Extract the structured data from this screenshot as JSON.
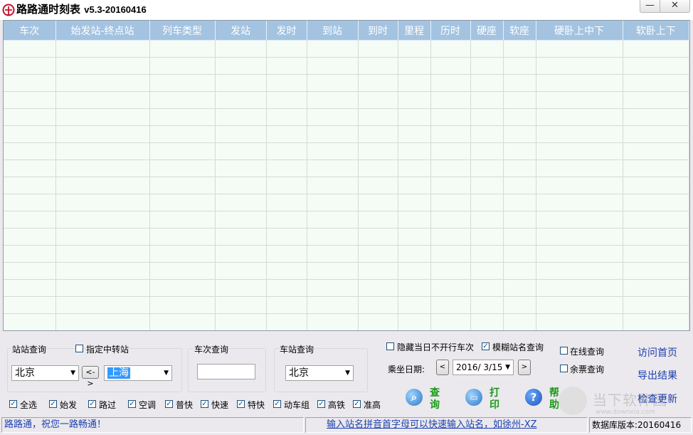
{
  "window": {
    "title": "路路通时刻表",
    "version": "v5.3-20160416",
    "minimize_glyph": "—",
    "close_glyph": "✕"
  },
  "table": {
    "columns": [
      "车次",
      "始发站-终点站",
      "列车类型",
      "发站",
      "发时",
      "到站",
      "到时",
      "里程",
      "历时",
      "硬座",
      "软座",
      "硬卧上中下",
      "软卧上下"
    ],
    "row_count": 17
  },
  "station_query": {
    "label": "站站查询",
    "transfer_label": "指定中转站",
    "from": "北京",
    "swap_label": "<->",
    "to": "上海"
  },
  "train_query": {
    "label": "车次查询",
    "value": ""
  },
  "stop_query": {
    "label": "车站查询",
    "station": "北京"
  },
  "options": {
    "hide_not_running": "隐藏当日不开行车次",
    "fuzzy_match": "模糊站名查询",
    "date_label": "乘坐日期:",
    "date_value": "2016/ 3/15",
    "prev": "<",
    "next": ">",
    "online_query": "在线查询",
    "remaining_tickets": "余票查询"
  },
  "actions": {
    "query": "查询",
    "print": "打印",
    "help": "帮助"
  },
  "links": {
    "home": "访问首页",
    "export": "导出结果",
    "update": "检查更新"
  },
  "filters": [
    {
      "label": "全选",
      "checked": true
    },
    {
      "label": "始发",
      "checked": true
    },
    {
      "label": "路过",
      "checked": true
    },
    {
      "label": "空调",
      "checked": true
    },
    {
      "label": "普快",
      "checked": true
    },
    {
      "label": "快速",
      "checked": true
    },
    {
      "label": "特快",
      "checked": true
    },
    {
      "label": "动车组",
      "checked": true
    },
    {
      "label": "高铁",
      "checked": true
    },
    {
      "label": "准高",
      "checked": true
    }
  ],
  "status": {
    "greeting": "路路通，祝您一路畅通！",
    "tip": "输入站名拼音首字母可以快速输入站名，如徐州-XZ",
    "db_version": "数据库版本:20160416"
  },
  "watermark": {
    "text": "当下软件园",
    "url": "www.downxia.com"
  },
  "colors": {
    "header": "#a3c3e1",
    "grid_bg": "#f5fbf5",
    "action_green": "#1a9a1a",
    "link_blue": "#1c3fb0"
  }
}
